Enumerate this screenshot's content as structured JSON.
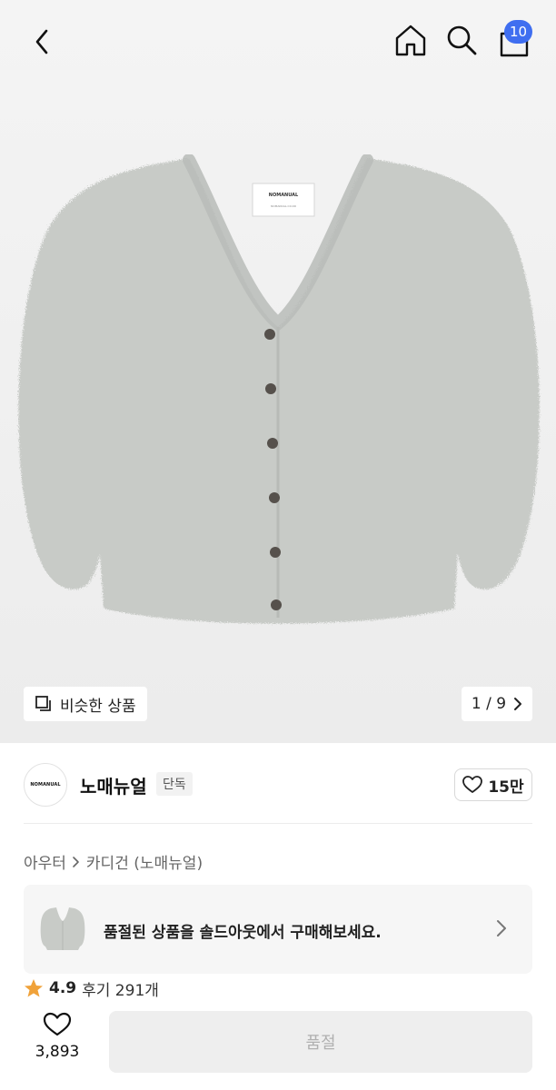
{
  "header": {
    "cart_count": "10",
    "icons": [
      "chevron-left-icon",
      "home-icon",
      "search-icon",
      "bag-icon"
    ]
  },
  "gallery": {
    "similar_label": "비슷한 상품",
    "pager": "1 / 9",
    "tag_brand": "NOMANUAL",
    "tag_small": "NOMANUAL.CO.KR"
  },
  "brand": {
    "logo_text": "NOMANUAL",
    "name": "노매뉴얼",
    "tag": "단독",
    "likes": "15만"
  },
  "breadcrumb": {
    "category": "아우터",
    "sub": "카디건 (노매뉴얼)"
  },
  "soldout": {
    "message": "품절된 상품을 솔드아웃에서 구매해보세요."
  },
  "rating": {
    "score": "4.9",
    "reviews": "후기 291개"
  },
  "bottom": {
    "wish_count": "3,893",
    "buy_label": "품절"
  },
  "colors": {
    "badge": "#3f6ef0",
    "star": "#f0a23a",
    "cardigan": "#c9ccc8"
  }
}
